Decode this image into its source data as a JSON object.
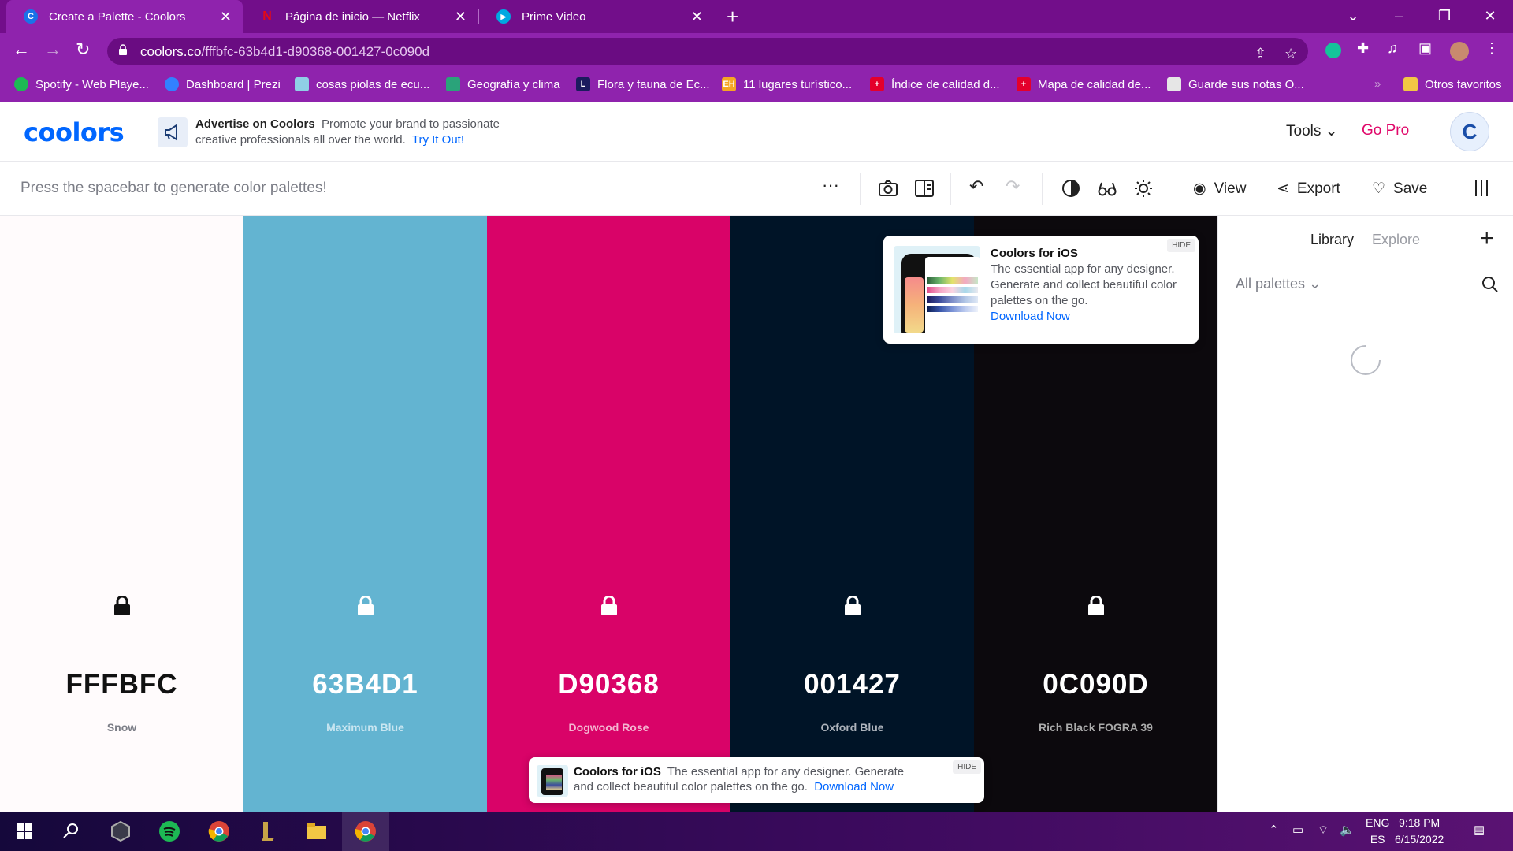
{
  "browser": {
    "tabs": [
      {
        "label": "Create a Palette - Coolors",
        "favicon_color": "#1a73e8"
      },
      {
        "label": "Página de inicio — Netflix",
        "favicon_color": "#e50914"
      },
      {
        "label": "Prime Video",
        "favicon_color": "#00a8e1"
      }
    ],
    "url_host": "coolors.co",
    "url_path": "/fffbfc-63b4d1-d90368-001427-0c090d",
    "bookmarks": [
      {
        "label": "Spotify - Web Playe...",
        "icon_color": "#1db954"
      },
      {
        "label": "Dashboard | Prezi",
        "icon_color": "#3181ff"
      },
      {
        "label": "cosas piolas de ecu...",
        "icon_color": "#8fd0e6"
      },
      {
        "label": "Geografía y clima",
        "icon_color": "#2aa37a"
      },
      {
        "label": "Flora y fauna de Ec...",
        "icon_color": "#1b1b5e"
      },
      {
        "label": "11 lugares turístico...",
        "icon_color": "#f5a623"
      },
      {
        "label": "Índice de calidad d...",
        "icon_color": "#e4002b"
      },
      {
        "label": "Mapa de calidad de...",
        "icon_color": "#e4002b"
      },
      {
        "label": "Guarde sus notas O...",
        "icon_color": "#e6e6e6"
      }
    ],
    "other_bookmarks": "Otros favoritos"
  },
  "header": {
    "logo": "coolors",
    "ad_title": "Advertise on Coolors",
    "ad_text": "Promote your brand to passionate creative professionals all over the world.",
    "ad_link": "Try It Out!",
    "tools": "Tools",
    "gopro": "Go Pro",
    "avatar": "C"
  },
  "toolbar": {
    "hint": "Press the spacebar to generate color palettes!",
    "view": "View",
    "export": "Export",
    "save": "Save"
  },
  "palette": [
    {
      "hex": "FFFBFC",
      "name": "Snow",
      "color": "#fffbfc",
      "text_color": "#111111",
      "name_color": "#7b7d86"
    },
    {
      "hex": "63B4D1",
      "name": "Maximum Blue",
      "color": "#63b4d1",
      "text_color": "#ffffff",
      "name_color": "#c9e6f1"
    },
    {
      "hex": "D90368",
      "name": "Dogwood Rose",
      "color": "#d90368",
      "text_color": "#ffffff",
      "name_color": "#f3b6d0"
    },
    {
      "hex": "001427",
      "name": "Oxford Blue",
      "color": "#001427",
      "text_color": "#ffffff",
      "name_color": "#aeb4bc"
    },
    {
      "hex": "0C090D",
      "name": "Rich Black FOGRA 39",
      "color": "#0c090d",
      "text_color": "#ffffff",
      "name_color": "#aaaaaa"
    }
  ],
  "panel": {
    "library": "Library",
    "explore": "Explore",
    "filter": "All palettes"
  },
  "ios_popup": {
    "title": "Coolors for iOS",
    "desc": "The essential app for any designer. Generate and collect beautiful color palettes on the go.",
    "link": "Download Now",
    "hide": "HIDE"
  },
  "ios_bar": {
    "title": "Coolors for iOS",
    "desc": "The essential app for any designer. Generate and collect beautiful color palettes on the go.",
    "link": "Download Now",
    "hide": "HIDE"
  },
  "taskbar": {
    "lang1": "ENG",
    "lang2": "ES",
    "time": "9:18 PM",
    "date": "6/15/2022"
  }
}
